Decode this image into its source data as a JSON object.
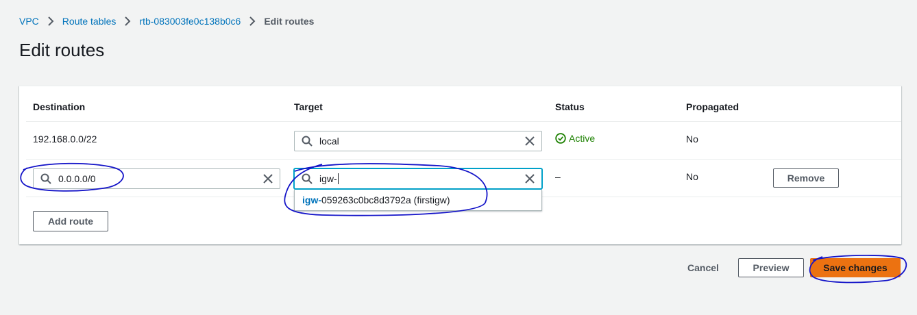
{
  "breadcrumb": {
    "items": [
      "VPC",
      "Route tables",
      "rtb-083003fe0c138b0c6"
    ],
    "current": "Edit routes"
  },
  "page": {
    "title": "Edit routes"
  },
  "table": {
    "headers": {
      "destination": "Destination",
      "target": "Target",
      "status": "Status",
      "propagated": "Propagated"
    },
    "rows": [
      {
        "destination": "192.168.0.0/22",
        "target": "local",
        "status": "Active",
        "propagated": "No"
      },
      {
        "destination": "0.0.0.0/0",
        "target": "igw-",
        "status": "–",
        "propagated": "No",
        "remove_label": "Remove"
      }
    ],
    "dropdown_option": {
      "match": "igw-",
      "rest": "059263c0bc8d3792a (firstigw)"
    },
    "add_route_label": "Add route"
  },
  "footer": {
    "cancel_label": "Cancel",
    "preview_label": "Preview",
    "save_label": "Save changes"
  },
  "colors": {
    "link": "#0073bb",
    "success": "#1d8102",
    "primary": "#ec7211",
    "focus": "#00a1c9",
    "annotation": "#1414c8"
  }
}
